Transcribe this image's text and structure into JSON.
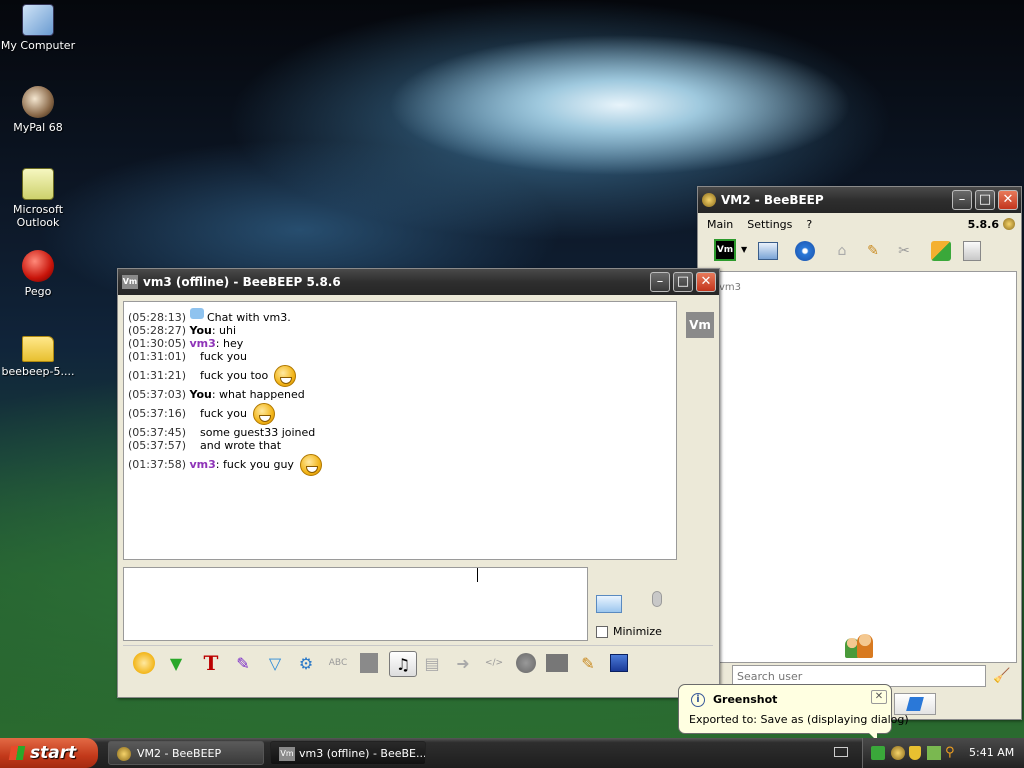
{
  "desktop": {
    "icons": [
      {
        "label": "My Computer",
        "icon": "computer-icon"
      },
      {
        "label": "MyPal 68",
        "icon": "mypal-icon"
      },
      {
        "label": "Microsoft Outlook",
        "icon": "outlook-icon"
      },
      {
        "label": "Pego",
        "icon": "pego-icon"
      },
      {
        "label": "beebeep-5....",
        "icon": "folder-icon"
      }
    ]
  },
  "chat_window": {
    "title": "vm3 (offline) - BeeBEEP 5.8.6",
    "app_icon": "Vm",
    "side_avatar": "Vm",
    "messages": [
      {
        "time": "(05:28:13)",
        "icon": "chat-bubble-icon",
        "name": "",
        "text": "Chat with vm3."
      },
      {
        "time": "(05:28:27)",
        "name": "You",
        "text": ": uhi"
      },
      {
        "time": "(01:30:05)",
        "name": "vm3",
        "text": ": hey"
      },
      {
        "time": "(01:31:01)",
        "name": "",
        "text": "fuck you"
      },
      {
        "time": "(01:31:21)",
        "name": "",
        "text": "fuck you too",
        "emoji": "grin-emoji"
      },
      {
        "time": "(05:37:03)",
        "name": "You",
        "text": ": what happened"
      },
      {
        "time": "(05:37:16)",
        "name": "",
        "text": "fuck you",
        "emoji": "grin-emoji"
      },
      {
        "time": "(05:37:45)",
        "name": "",
        "text": "some guest33 joined"
      },
      {
        "time": "(05:37:57)",
        "name": "",
        "text": "and wrote that"
      },
      {
        "time": "(01:37:58)",
        "name": "vm3",
        "text": ": fuck you guy",
        "emoji": "grin-emoji"
      }
    ],
    "input_value": "",
    "minimize_label": "Minimize",
    "toolbar_icons": [
      "emoticon-icon",
      "green-arrow-icon",
      "font-icon",
      "color-picker-icon",
      "filter-icon",
      "settings-icon",
      "spellcheck-icon",
      "dictionary-icon",
      "note-icon",
      "file-icon",
      "forward-icon",
      "code-icon",
      "record-icon",
      "screenshot-icon",
      "edit-icon",
      "save-icon"
    ]
  },
  "main_window": {
    "title": "VM2 - BeeBEEP",
    "menu": [
      "Main",
      "Settings",
      "?"
    ],
    "version": "5.8.6",
    "status_badge": "Vm",
    "user_list": [
      "vm3"
    ],
    "search_placeholder": "Search user",
    "toolbar_icons": [
      "status-icon",
      "edit-profile-icon",
      "network-icon",
      "home-icon",
      "pencil-icon",
      "tools-icon",
      "update-icon",
      "trash-icon"
    ]
  },
  "balloon": {
    "title": "Greenshot",
    "text": "Exported to: Save as (displaying dialog)"
  },
  "taskbar": {
    "start_label": "start",
    "tasks": [
      {
        "label": "VM2 - BeeBEEP"
      },
      {
        "label": "vm3 (offline) - BeeBE..."
      }
    ],
    "clock": "5:41 AM"
  }
}
